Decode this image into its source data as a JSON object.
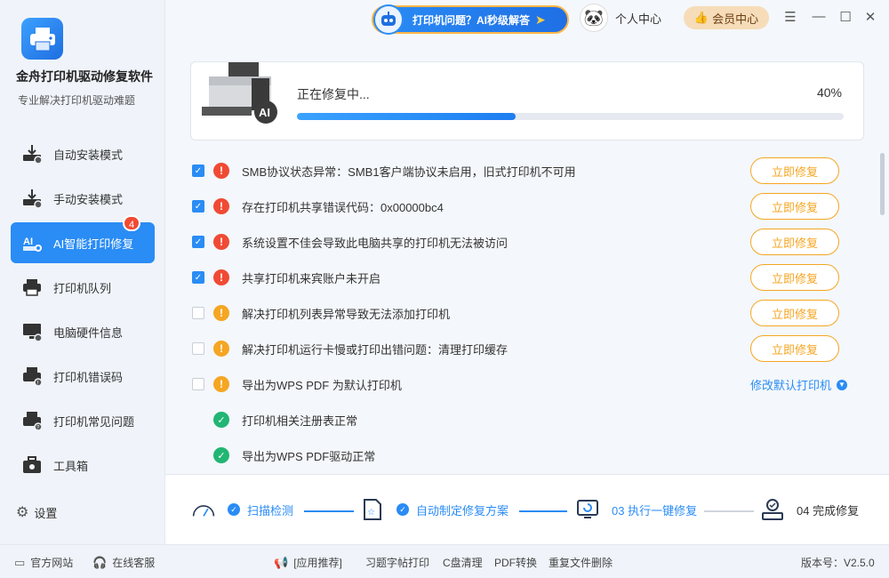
{
  "app": {
    "title": "金舟打印机驱动修复软件",
    "subtitle": "专业解决打印机驱动难题"
  },
  "sidebar": {
    "items": [
      {
        "label": "自动安装模式",
        "icon": "auto-install-icon"
      },
      {
        "label": "手动安装模式",
        "icon": "manual-install-icon"
      },
      {
        "label": "AI智能打印修复",
        "icon": "ai-repair-icon",
        "badge": "4"
      },
      {
        "label": "打印机队列",
        "icon": "printer-queue-icon"
      },
      {
        "label": "电脑硬件信息",
        "icon": "hardware-info-icon"
      },
      {
        "label": "打印机错误码",
        "icon": "error-code-icon"
      },
      {
        "label": "打印机常见问题",
        "icon": "faq-icon"
      },
      {
        "label": "工具箱",
        "icon": "toolbox-icon"
      }
    ],
    "settings_label": "设置"
  },
  "topbar": {
    "ai_question": "打印机问题？AI秒级解答",
    "user_center": "个人中心",
    "vip_center": "会员中心"
  },
  "progress": {
    "label": "正在修复中...",
    "percent_text": "40%",
    "value": 0.4
  },
  "issues": [
    {
      "text": "SMB协议状态异常：SMB1客户端协议未启用，旧式打印机不可用",
      "checked": true,
      "status": "error",
      "action": "立即修复"
    },
    {
      "text": "存在打印机共享错误代码：0x00000bc4",
      "checked": true,
      "status": "error",
      "action": "立即修复"
    },
    {
      "text": "系统设置不佳会导致此电脑共享的打印机无法被访问",
      "checked": true,
      "status": "error",
      "action": "立即修复"
    },
    {
      "text": "共享打印机来宾账户未开启",
      "checked": true,
      "status": "error",
      "action": "立即修复"
    },
    {
      "text": "解决打印机列表异常导致无法添加打印机",
      "checked": false,
      "status": "warning",
      "action": "立即修复"
    },
    {
      "text": "解决打印机运行卡慢或打印出错问题：清理打印缓存",
      "checked": false,
      "status": "warning",
      "action": "立即修复"
    },
    {
      "text": "导出为WPS PDF 为默认打印机",
      "checked": false,
      "status": "warning",
      "link": "修改默认打印机"
    },
    {
      "text": "打印机相关注册表正常",
      "status": "ok"
    },
    {
      "text": "导出为WPS PDF驱动正常",
      "status": "ok"
    }
  ],
  "steps": [
    {
      "label": "扫描检测",
      "state": "done"
    },
    {
      "label": "自动制定修复方案",
      "state": "done"
    },
    {
      "label": "03 执行一键修复",
      "state": "active"
    },
    {
      "label": "04 完成修复",
      "state": "todo"
    }
  ],
  "footer": {
    "official_site": "官方网站",
    "online_service": "在线客服",
    "app_recommend": "[应用推荐]",
    "recommend_links": [
      "习题字帖打印",
      "C盘清理",
      "PDF转换",
      "重复文件删除"
    ],
    "version": "版本号：V2.5.0"
  },
  "colors": {
    "primary": "#2a8cf5",
    "error": "#f04a34",
    "warning": "#f5a623",
    "ok": "#22b573",
    "vip": "#f6dcb8"
  }
}
